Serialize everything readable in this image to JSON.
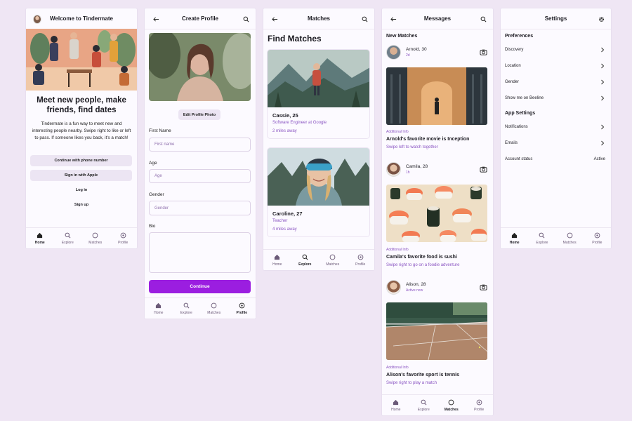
{
  "colors": {
    "background": "#efe6f4",
    "screen": "#fcfaff",
    "accent": "#9b1ee0",
    "accent_text": "#8a55c2"
  },
  "nav": {
    "home": "Home",
    "explore": "Explore",
    "matches": "Matches",
    "profile": "Profile"
  },
  "welcome": {
    "title": "Welcome to Tindermate",
    "headline": "Meet new people, make friends, find dates",
    "description": "Tindermate is a fun way to meet new and interesting people nearby. Swipe right to like or left to pass. If someone likes you back, it's a match!",
    "phone_button": "Continue with phone number",
    "apple_button": "Sign in with Apple",
    "login": "Log in",
    "signup": "Sign up"
  },
  "create_profile": {
    "title": "Create Profile",
    "edit_photo": "Edit Profile Photo",
    "first_name_label": "First Name",
    "first_name_placeholder": "First   name",
    "age_label": "Age",
    "age_placeholder": "Age",
    "gender_label": "Gender",
    "gender_placeholder": "Gender",
    "bio_label": "Bio",
    "continue": "Continue"
  },
  "matches": {
    "title": "Matches",
    "heading": "Find Matches",
    "cards": [
      {
        "name": "Cassie, 25",
        "job": "Software Engineer at Google",
        "distance": "2 miles away"
      },
      {
        "name": "Caroline, 27",
        "job": "Teacher",
        "distance": "4 miles away"
      }
    ]
  },
  "messages": {
    "title": "Messages",
    "section": "New Matches",
    "items": [
      {
        "name": "Arnold, 30",
        "time": "2d",
        "tag": "Additional Info",
        "title": "Arnold's favorite movie is Inception",
        "sub": "Swipe left to watch together"
      },
      {
        "name": "Camila, 28",
        "time": "1h",
        "tag": "Additional Info",
        "title": "Camila's favorite food is sushi",
        "sub": "Swipe right to go on a foodie adventure"
      },
      {
        "name": "Alison, 28",
        "time": "Active now",
        "tag": "Additional Info",
        "title": "Alison's favorite sport is tennis",
        "sub": "Swipe right to play a match"
      }
    ]
  },
  "settings": {
    "title": "Settings",
    "preferences": "Preferences",
    "pref_items": [
      "Discovery",
      "Location",
      "Gender",
      "Show me on Beeline"
    ],
    "app_settings": "App Settings",
    "app_items": [
      "Notifications",
      "Emails"
    ],
    "account_status_label": "Account status",
    "account_status_value": "Active"
  }
}
